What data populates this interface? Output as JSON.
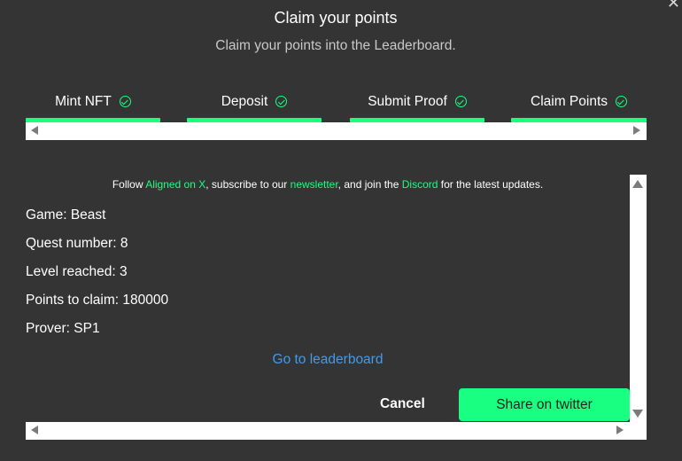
{
  "window": {
    "close_icon": "close-icon"
  },
  "header": {
    "title": "Claim your points",
    "subtitle": "Claim your points into the Leaderboard."
  },
  "steps": [
    {
      "label": "Mint NFT",
      "done": true
    },
    {
      "label": "Deposit",
      "done": true
    },
    {
      "label": "Submit Proof",
      "done": true
    },
    {
      "label": "Claim Points",
      "done": true
    }
  ],
  "follow": {
    "prefix": "Follow ",
    "link_x": "Aligned on X",
    "mid1": ", subscribe to our ",
    "link_newsletter": "newsletter",
    "mid2": ", and join the ",
    "link_discord": "Discord",
    "suffix": " for the latest updates."
  },
  "details": {
    "game": "Game: Beast",
    "quest": "Quest number: 8",
    "level": "Level reached: 3",
    "points": "Points to claim: 180000",
    "prover": "Prover: SP1"
  },
  "actions": {
    "leaderboard_link": "Go to leaderboard",
    "cancel": "Cancel",
    "share": "Share on twitter"
  },
  "colors": {
    "background": "#343434",
    "accent": "#19ff82",
    "link_blue": "#3f9bf0"
  }
}
